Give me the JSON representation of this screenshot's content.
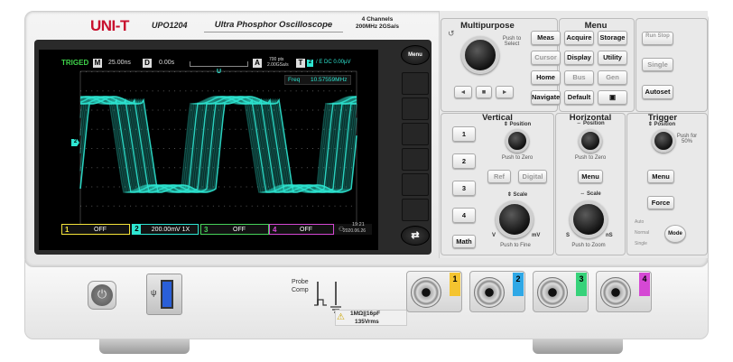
{
  "brand": {
    "logo": "UNI-T",
    "model": "UPO1204",
    "subtitle": "Ultra Phosphor Oscilloscope",
    "channels": "4 Channels",
    "spec": "200MHz 2GSa/s"
  },
  "screen": {
    "trigger_state": "TRIGED",
    "timebase_marker": "M",
    "timebase": "25.00ns",
    "delay_marker": "D",
    "delay": "0.00s",
    "acq_marker": "A",
    "points": "700 pts",
    "sample_rate": "2.00GSa/s",
    "trigger_marker": "T",
    "trigger_ch": "2",
    "trigger_info": "/ E DC 0.00µV",
    "trig_pos_marker": "U",
    "freq_label": "Freq",
    "freq_value": "10.57559MHz",
    "ch_level_marker": "2",
    "status": [
      {
        "ch": "1",
        "text": "OFF",
        "color": "#f4e33a"
      },
      {
        "ch": "2",
        "text": "200.00mV 1X",
        "color": "#2ee6d2"
      },
      {
        "ch": "3",
        "text": "OFF",
        "color": "#46d25a"
      },
      {
        "ch": "4",
        "text": "OFF",
        "color": "#d548d4"
      }
    ],
    "time": "19:21",
    "date": "2020.06.26"
  },
  "softkeys": {
    "menu": "Menu",
    "swap": "⇄"
  },
  "multipurpose": {
    "title": "Multipurpose",
    "push_label": "Push to Select"
  },
  "menu": {
    "title": "Menu",
    "buttons": [
      "Meas",
      "Acquire",
      "Storage",
      "Cursor",
      "Display",
      "Utility",
      "Home",
      "Bus",
      "Gen",
      "Navigate",
      "Default",
      "▣"
    ]
  },
  "run": {
    "runstop": "Run Stop",
    "single": "Single",
    "autoset": "Autoset"
  },
  "vertical": {
    "title": "Vertical",
    "position": "⇕ Position",
    "push_zero": "Push to Zero",
    "ch": [
      "1",
      "2",
      "3",
      "4"
    ],
    "math": "Math",
    "ref": "Ref",
    "digital": "Digital",
    "scale": "⇕ Scale",
    "v": "V",
    "mv": "mV",
    "push_fine": "Push to Fine"
  },
  "horizontal": {
    "title": "Horizontal",
    "position": "⇔ Position",
    "push_zero": "Push to Zero",
    "menu": "Menu",
    "scale": "⇔ Scale",
    "s": "S",
    "ns": "nS",
    "push_zoom": "Push to Zoom"
  },
  "trigger": {
    "title": "Trigger",
    "position": "⇕ Position",
    "push50": "Push for 50%",
    "menu": "Menu",
    "force": "Force",
    "auto": "Auto",
    "normal": "Normal",
    "single": "Single",
    "mode": "Mode"
  },
  "front": {
    "probe_comp": "Probe Comp",
    "impedance": "1MΩ||16pF",
    "vrms": "135Vrms",
    "ch_tags": [
      "1",
      "2",
      "3",
      "4"
    ],
    "ch_colors": [
      "#f4c430",
      "#2fa8e6",
      "#37d27a",
      "#d548d4"
    ]
  }
}
